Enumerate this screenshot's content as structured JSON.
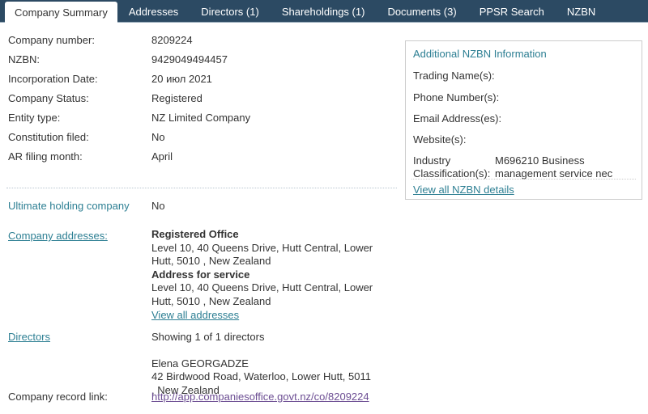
{
  "tabs": [
    {
      "label": "Company Summary",
      "active": true
    },
    {
      "label": "Addresses",
      "active": false
    },
    {
      "label": "Directors (1)",
      "active": false
    },
    {
      "label": "Shareholdings (1)",
      "active": false
    },
    {
      "label": "Documents (3)",
      "active": false
    },
    {
      "label": "PPSR Search",
      "active": false
    },
    {
      "label": "NZBN",
      "active": false
    }
  ],
  "summary": {
    "fields": [
      {
        "label": "Company number:",
        "value": "8209224"
      },
      {
        "label": "NZBN:",
        "value": "9429049494457"
      },
      {
        "label": "Incorporation Date:",
        "value": "20 июл 2021"
      },
      {
        "label": "Company Status:",
        "value": "Registered"
      },
      {
        "label": "Entity type:",
        "value": "NZ Limited Company"
      },
      {
        "label": "Constitution filed:",
        "value": "No"
      },
      {
        "label": "AR filing month:",
        "value": "April"
      }
    ],
    "ultimate_holding": {
      "label": "Ultimate holding company",
      "value": "No"
    },
    "company_addresses": {
      "label": "Company addresses:",
      "registered_office_heading": "Registered Office",
      "registered_office_line1": "Level 10, 40 Queens Drive, Hutt Central, Lower",
      "registered_office_line2": "Hutt, 5010 , New Zealand",
      "service_heading": "Address for service",
      "service_line1": "Level 10, 40 Queens Drive, Hutt Central, Lower",
      "service_line2": "Hutt, 5010 , New Zealand",
      "view_all_link": "View all addresses"
    },
    "directors": {
      "label": "Directors",
      "showing": "Showing 1 of 1 directors",
      "name": "Elena GEORGADZE",
      "address_line1": "42 Birdwood Road, Waterloo, Lower Hutt, 5011",
      "address_line2": ", New Zealand"
    },
    "record_link": {
      "label": "Company record link:",
      "url": "http://app.companiesoffice.govt.nz/co/8209224"
    }
  },
  "nzbn_box": {
    "title": "Additional NZBN Information",
    "rows": [
      {
        "label": "Trading Name(s):",
        "value": ""
      },
      {
        "label": "Phone Number(s):",
        "value": ""
      },
      {
        "label": "Email Address(es):",
        "value": ""
      },
      {
        "label": "Website(s):",
        "value": ""
      }
    ],
    "industry_label_line1": "Industry",
    "industry_label_line2": "Classification(s):",
    "industry_value_line1": "M696210 Business",
    "industry_value_line2": "management service nec",
    "view_link": "View all NZBN details"
  },
  "colors": {
    "tabbar_bg": "#2c4a63",
    "link_teal": "#2d7f93",
    "visited_link": "#6b4c92",
    "text": "#333333",
    "box_border": "#cccccc"
  }
}
